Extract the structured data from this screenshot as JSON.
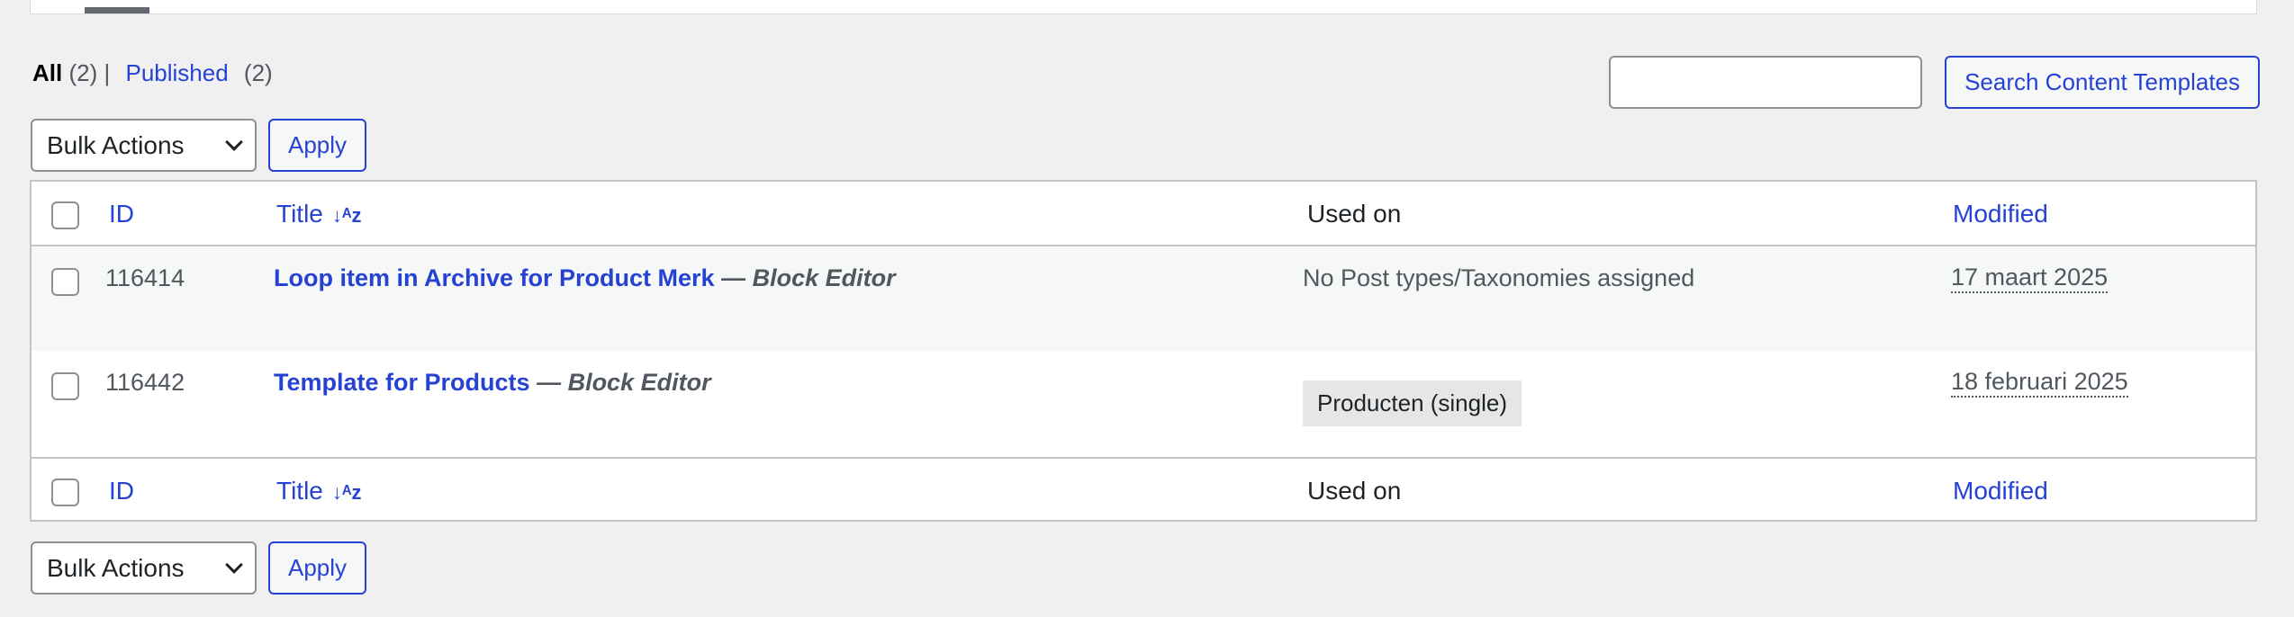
{
  "filters": {
    "all_label": "All",
    "all_count": "(2)",
    "separator": "|",
    "published_label": "Published",
    "published_count": "(2)"
  },
  "search": {
    "input_value": "",
    "button_label": "Search Content Templates"
  },
  "bulk": {
    "select_value": "Bulk Actions",
    "apply_label": "Apply"
  },
  "table": {
    "columns": {
      "id": "ID",
      "title": "Title",
      "used_on": "Used on",
      "modified": "Modified"
    },
    "sort_icon": "↓ᴬz",
    "rows": [
      {
        "id": "116414",
        "title": "Loop item in Archive for Product Merk",
        "state": "— Block Editor",
        "used_on": "No Post types/Taxonomies assigned",
        "modified": "17 maart 2025"
      },
      {
        "id": "116442",
        "title": "Template for Products",
        "state": "— Block Editor",
        "used_on_tag": "Producten (single)",
        "modified": "18 februari 2025"
      }
    ]
  }
}
